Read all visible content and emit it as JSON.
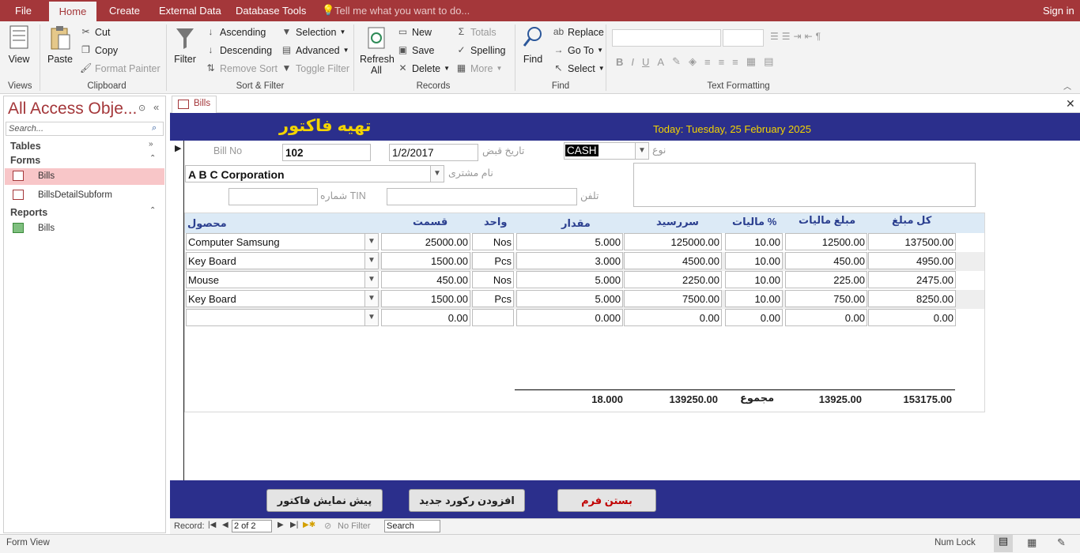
{
  "menu": {
    "file": "File",
    "home": "Home",
    "create": "Create",
    "external": "External Data",
    "dbtools": "Database Tools",
    "tell": "Tell me what you want to do...",
    "signin": "Sign in"
  },
  "ribbon": {
    "view": "View",
    "paste": "Paste",
    "cut": "Cut",
    "copy": "Copy",
    "format_painter": "Format Painter",
    "filter": "Filter",
    "ascending": "Ascending",
    "descending": "Descending",
    "remove_sort": "Remove Sort",
    "selection": "Selection",
    "advanced": "Advanced",
    "toggle_filter": "Toggle Filter",
    "refresh": "Refresh",
    "refresh_all": "All",
    "new": "New",
    "save": "Save",
    "delete": "Delete",
    "totals": "Totals",
    "spelling": "Spelling",
    "more": "More",
    "find": "Find",
    "replace": "Replace",
    "goto": "Go To",
    "select": "Select",
    "groups": {
      "views": "Views",
      "clipboard": "Clipboard",
      "sort_filter": "Sort & Filter",
      "records": "Records",
      "find": "Find",
      "text_formatting": "Text Formatting"
    }
  },
  "nav": {
    "title": "All Access Obje...",
    "search_placeholder": "Search...",
    "categories": {
      "tables": "Tables",
      "forms": "Forms",
      "reports": "Reports"
    },
    "forms": [
      "Bills",
      "BillsDetailSubform"
    ],
    "reports": [
      "Bills"
    ]
  },
  "form": {
    "tab": "Bills",
    "title": "تهیه فاکتور",
    "today": "Today: Tuesday, 25 February 2025",
    "labels": {
      "bill_no": "Bill No",
      "receipt_date": "تاریخ قبض",
      "type": "نوع",
      "customer": "نام مشتری",
      "tin": "شماره TIN",
      "phone": "تلفن"
    },
    "bill_no": "102",
    "receipt_date": "1/2/2017",
    "type": "CASH",
    "customer": "A B C Corporation",
    "tin": "",
    "phone": "",
    "columns": {
      "product": "محصول",
      "price": "قسمت",
      "unit": "واحد",
      "qty": "مقدار",
      "subtotal": "سررسید",
      "tax_pct": "مالیات %",
      "tax_amt": "مبلغ مالیات",
      "total": "کل مبلغ"
    },
    "rows": [
      {
        "product": "Computer Samsung",
        "price": "25000.00",
        "unit": "Nos",
        "qty": "5.000",
        "subtotal": "125000.00",
        "tax_pct": "10.00",
        "tax_amt": "12500.00",
        "total": "137500.00"
      },
      {
        "product": "Key Board",
        "price": "1500.00",
        "unit": "Pcs",
        "qty": "3.000",
        "subtotal": "4500.00",
        "tax_pct": "10.00",
        "tax_amt": "450.00",
        "total": "4950.00"
      },
      {
        "product": "Mouse",
        "price": "450.00",
        "unit": "Nos",
        "qty": "5.000",
        "subtotal": "2250.00",
        "tax_pct": "10.00",
        "tax_amt": "225.00",
        "total": "2475.00"
      },
      {
        "product": "Key Board",
        "price": "1500.00",
        "unit": "Pcs",
        "qty": "5.000",
        "subtotal": "7500.00",
        "tax_pct": "10.00",
        "tax_amt": "750.00",
        "total": "8250.00"
      },
      {
        "product": "",
        "price": "0.00",
        "unit": "",
        "qty": "0.000",
        "subtotal": "0.00",
        "tax_pct": "0.00",
        "tax_amt": "0.00",
        "total": "0.00"
      }
    ],
    "totals": {
      "qty": "18.000",
      "subtotal": "139250.00",
      "label": "مجموع",
      "tax_amt": "13925.00",
      "total": "153175.00"
    },
    "buttons": {
      "preview": "پیش نمایش فاکتور",
      "add": "افزودن رکورد جدید",
      "close": "بستن فرم"
    }
  },
  "recnav": {
    "record": "Record:",
    "position": "2 of 2",
    "nofilter": "No Filter",
    "search": "Search"
  },
  "status": {
    "view": "Form View",
    "numlock": "Num Lock"
  }
}
